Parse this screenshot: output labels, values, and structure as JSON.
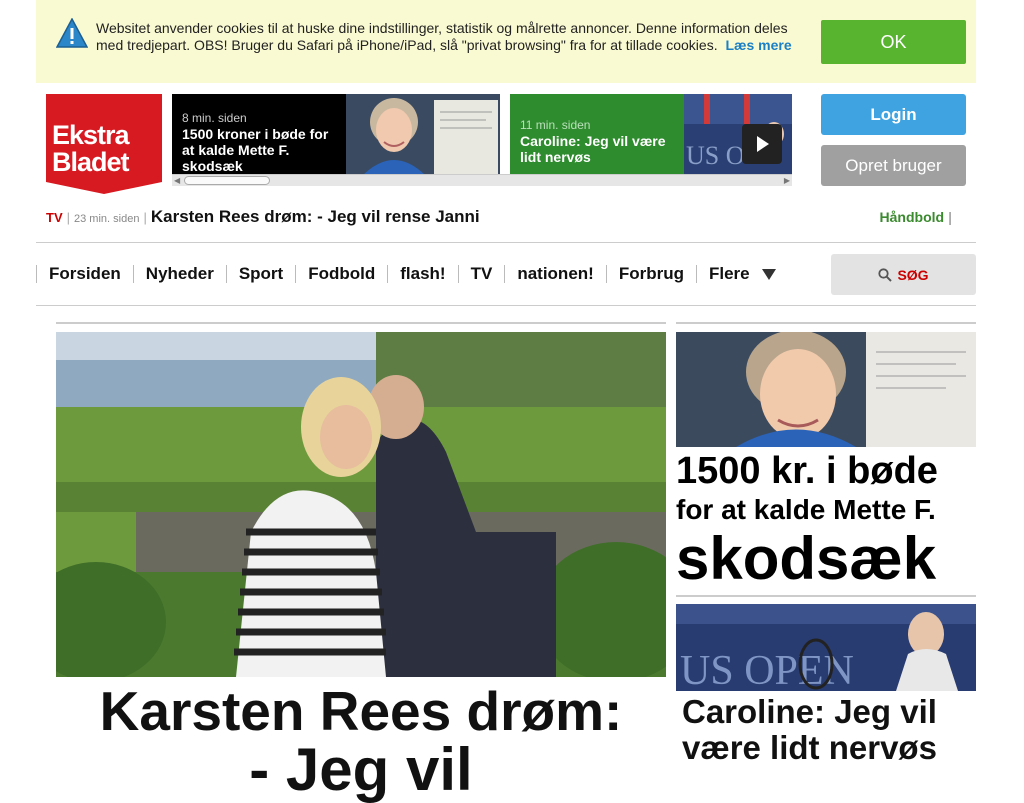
{
  "cookie_banner": {
    "message": "Websitet anvender cookies til at huske dine indstillinger, statistik og målrette annoncer. Denne information deles med tredjepart. OBS! Bruger du Safari på iPhone/iPad, slå \"privat browsing\" fra for at tillade cookies.",
    "link_label": "Læs mere",
    "ok_label": "OK"
  },
  "logo": {
    "line1": "Ekstra",
    "line2": "Bladet"
  },
  "ticker": [
    {
      "time": "8 min. siden",
      "headline": "1500 kroner i bøde for at kalde Mette F. skodsæk"
    },
    {
      "time": "11 min. siden",
      "headline": "Caroline: Jeg vil være lidt nervøs"
    }
  ],
  "account": {
    "login_label": "Login",
    "create_label": "Opret bruger"
  },
  "breaking": {
    "tag": "TV",
    "time": "23 min. siden",
    "title": "Karsten Rees drøm: - Jeg vil rense Janni",
    "category": "Håndbold"
  },
  "nav": {
    "items": [
      "Forsiden",
      "Nyheder",
      "Sport",
      "Fodbold",
      "flash!",
      "TV",
      "nationen!",
      "Forbrug"
    ],
    "more_label": "Flere",
    "search_label": "SØG"
  },
  "main_article": {
    "title_line1": "Karsten Rees drøm:",
    "title_line2": "- Jeg vil"
  },
  "side_articles": [
    {
      "line1": "1500 kr. i bøde",
      "line2": "for at kalde Mette F.",
      "line3": "skodsæk"
    },
    {
      "title": "Caroline: Jeg vil være lidt nervøs"
    }
  ],
  "colors": {
    "brand_red": "#d71921",
    "ok_green": "#58b42e",
    "login_blue": "#3ea3e0",
    "banner_bg": "#fafad2"
  }
}
